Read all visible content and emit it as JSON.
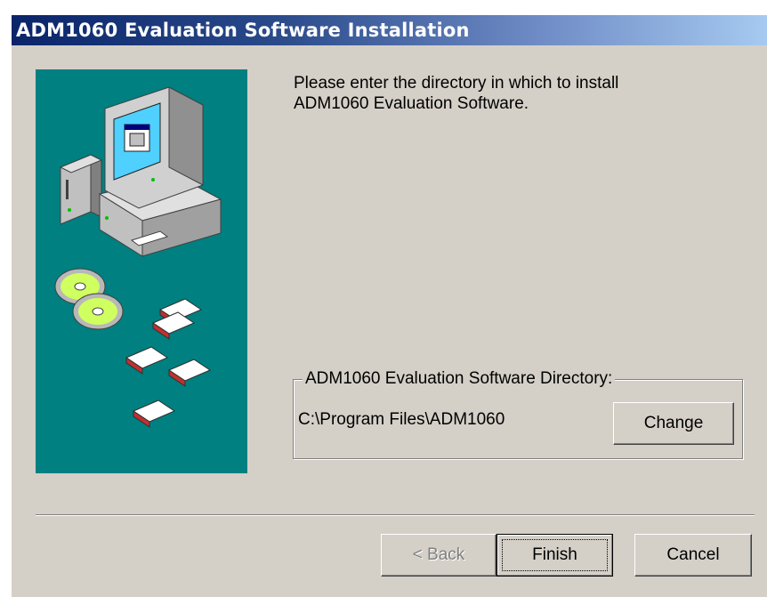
{
  "window": {
    "title": "ADM1060 Evaluation Software Installation"
  },
  "instructions": {
    "line1": "Please enter the directory in which to install",
    "line2": "ADM1060 Evaluation Software."
  },
  "directory_group": {
    "label": "ADM1060 Evaluation Software Directory:",
    "path": "C:\\Program Files\\ADM1060",
    "change_label": "Change"
  },
  "buttons": {
    "back_label": "< Back",
    "finish_label": "Finish",
    "cancel_label": "Cancel"
  },
  "colors": {
    "titlebar_start": "#0a246a",
    "titlebar_end": "#a6caf0",
    "dialog_face": "#d4d0c8",
    "art_background": "#008080"
  },
  "icons": [
    "computer-illustration",
    "cd-icon",
    "floppy-disk-icon"
  ]
}
